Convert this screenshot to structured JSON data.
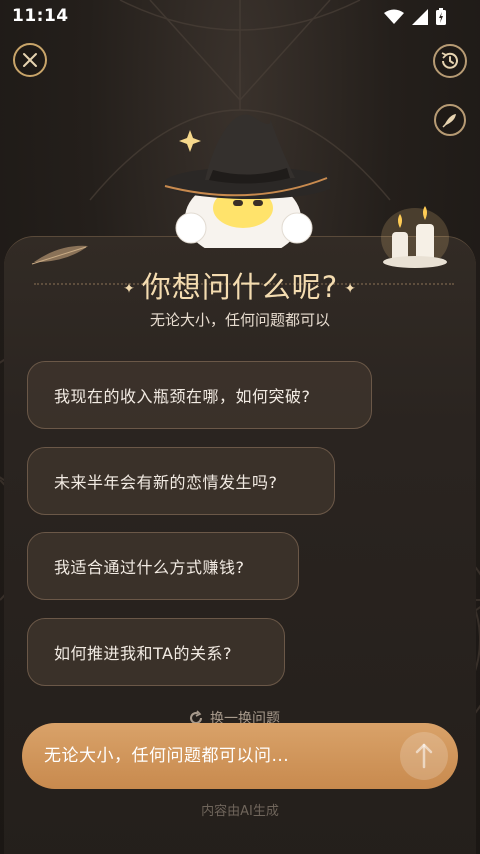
{
  "status_bar": {
    "time": "11:14",
    "icons": [
      "wifi-icon",
      "signal-icon",
      "battery-icon"
    ]
  },
  "header": {
    "close_icon": "close-icon",
    "history_icon": "history-icon",
    "feather_icon": "feather-icon"
  },
  "main": {
    "title": "你想问什么呢?",
    "subtitle": "无论大小，任何问题都可以",
    "suggestions": [
      "我现在的收入瓶颈在哪，如何突破?",
      "未来半年会有新的恋情发生吗?",
      "我适合通过什么方式赚钱?",
      "如何推进我和TA的关系?"
    ],
    "refresh_label": "换一换问题"
  },
  "input": {
    "placeholder": "无论大小，任何问题都可以问...",
    "send_icon": "arrow-up-icon"
  },
  "footer": {
    "note": "内容由AI生成"
  },
  "colors": {
    "accent": "#d09556",
    "title": "#f4dcb0",
    "background": "#241f1b"
  }
}
